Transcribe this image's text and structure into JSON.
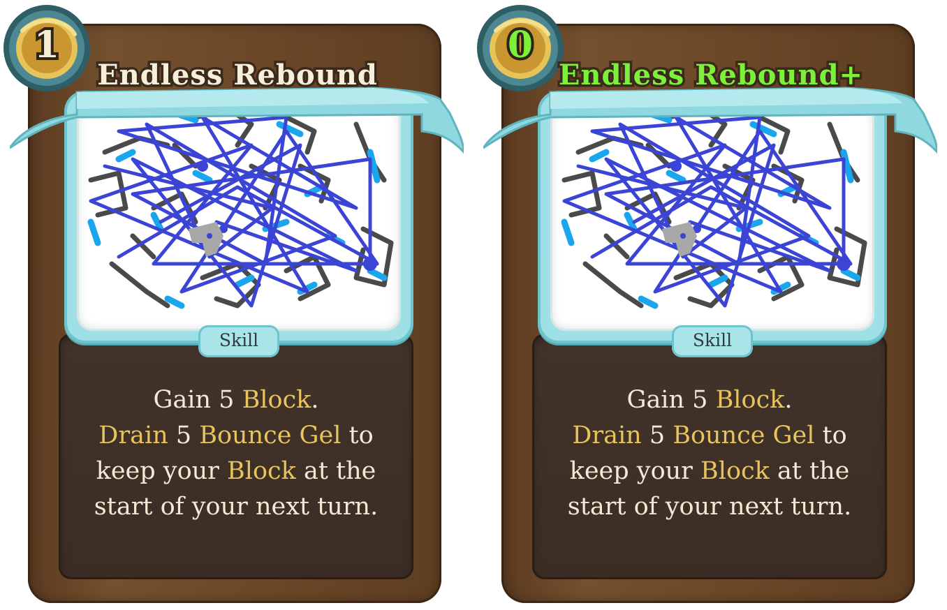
{
  "cards": [
    {
      "cost": "1",
      "title": "Endless Rebound",
      "type": "Skill",
      "upgraded": false,
      "desc": {
        "l1_a": "Gain 5 ",
        "l1_k": "Block",
        "l1_b": ".",
        "l2_k1": "Drain",
        "l2_a": " 5 ",
        "l2_k2": "Bounce Gel",
        "l2_b": " to",
        "l3_a": "keep your ",
        "l3_k": "Block",
        "l3_b": " at the",
        "l4": "start of your next turn."
      }
    },
    {
      "cost": "0",
      "title": "Endless Rebound+",
      "type": "Skill",
      "upgraded": true,
      "desc": {
        "l1_a": "Gain 5 ",
        "l1_k": "Block",
        "l1_b": ".",
        "l2_k1": "Drain",
        "l2_a": " 5 ",
        "l2_k2": "Bounce Gel",
        "l2_b": " to",
        "l3_a": "keep your ",
        "l3_k": "Block",
        "l3_b": " at the",
        "l4": "start of your next turn."
      }
    }
  ],
  "colors": {
    "frame": "#6b4828",
    "accent_frame": "#9fe0e6",
    "keyword": "#e8c45c",
    "upgraded": "#7cf03a",
    "text": "#f3ead6"
  }
}
